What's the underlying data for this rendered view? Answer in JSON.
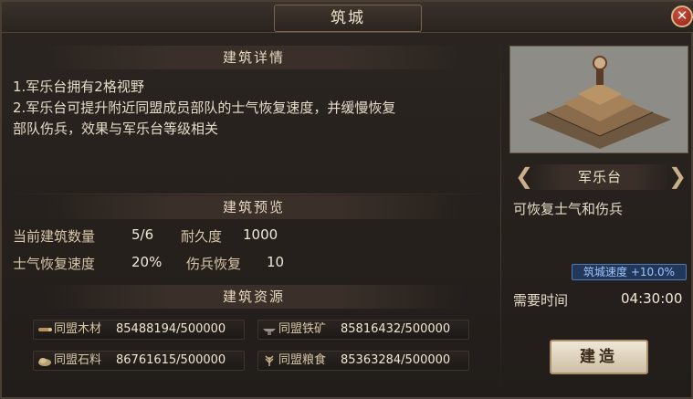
{
  "window": {
    "title": "筑城"
  },
  "details": {
    "header": "建筑详情",
    "lines": [
      "1.军乐台拥有2格视野",
      "2.军乐台可提升附近同盟成员部队的士气恢复速度，并缓慢恢复",
      "部队伤兵，效果与军乐台等级相关"
    ]
  },
  "preview": {
    "header": "建筑预览",
    "count_label": "当前建筑数量",
    "count_value": "5/6",
    "durability_label": "耐久度",
    "durability_value": "1000",
    "morale_label": "士气恢复速度",
    "morale_value": "20%",
    "wounded_label": "伤兵恢复",
    "wounded_value": "10"
  },
  "resources": {
    "header": "建筑资源",
    "items": [
      {
        "name": "同盟木材",
        "amount": "85488194/500000",
        "icon": "wood-icon"
      },
      {
        "name": "同盟铁矿",
        "amount": "85816432/500000",
        "icon": "iron-icon"
      },
      {
        "name": "同盟石料",
        "amount": "86761615/500000",
        "icon": "stone-icon"
      },
      {
        "name": "同盟粮食",
        "amount": "85363284/500000",
        "icon": "grain-icon"
      }
    ]
  },
  "building": {
    "name": "军乐台",
    "effect": "可恢复士气和伤兵",
    "speed_bonus": "筑城速度 +10.0%",
    "time_label": "需要时间",
    "time_value": "04:30:00",
    "build_label": "建造"
  },
  "colors": {
    "accent": "#c9b08a",
    "close": "#b73a2a",
    "badge": "#4f7ab8"
  }
}
